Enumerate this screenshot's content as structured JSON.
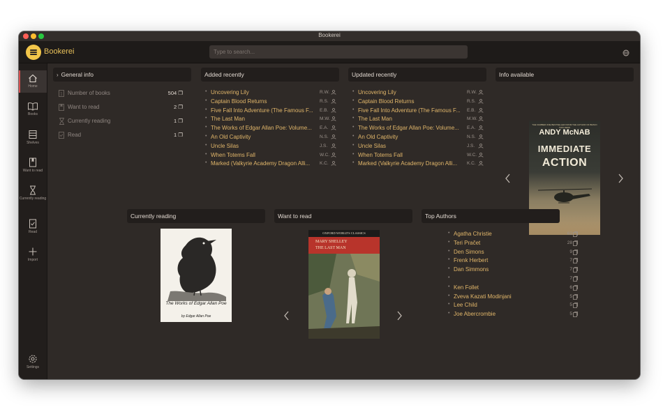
{
  "window": {
    "title": "Bookerei"
  },
  "app": {
    "name": "Bookerei"
  },
  "search": {
    "placeholder": "Type to search..."
  },
  "sidebar": {
    "items": [
      {
        "label": "Home",
        "icon": "home-icon"
      },
      {
        "label": "Books",
        "icon": "book-icon"
      },
      {
        "label": "Shelves",
        "icon": "shelves-icon"
      },
      {
        "label": "Want to read",
        "icon": "bookmark-icon"
      },
      {
        "label": "Currently reading",
        "icon": "hourglass-icon"
      },
      {
        "label": "Read",
        "icon": "bookmark-check-icon"
      },
      {
        "label": "Import",
        "icon": "plus-icon"
      }
    ],
    "settings_label": "Settings"
  },
  "general_info": {
    "title": "General info",
    "rows": [
      {
        "label": "Number of books",
        "count": "504"
      },
      {
        "label": "Want to read",
        "count": "2"
      },
      {
        "label": "Currently reading",
        "count": "1"
      },
      {
        "label": "Read",
        "count": "1"
      }
    ]
  },
  "added_recently": {
    "title": "Added recently",
    "items": [
      {
        "title": "Uncovering Lily",
        "author": "R.W."
      },
      {
        "title": "Captain Blood Returns",
        "author": "R.S."
      },
      {
        "title": "Five Fall Into Adventure (The Famous F...",
        "author": "E.B."
      },
      {
        "title": "The Last Man",
        "author": "M.W."
      },
      {
        "title": "The Works of Edgar Allan Poe: Volume...",
        "author": "E.A."
      },
      {
        "title": "An Old Captivity",
        "author": "N.S."
      },
      {
        "title": "Uncle Silas",
        "author": "J.S."
      },
      {
        "title": "When Totems Fall",
        "author": "W.C."
      },
      {
        "title": "Marked (Valkyrie Academy Dragon Alli...",
        "author": "K.C."
      }
    ]
  },
  "updated_recently": {
    "title": "Updated recently",
    "items": [
      {
        "title": "Uncovering Lily",
        "author": "R.W."
      },
      {
        "title": "Captain Blood Returns",
        "author": "R.S."
      },
      {
        "title": "Five Fall Into Adventure (The Famous F...",
        "author": "E.B."
      },
      {
        "title": "The Last Man",
        "author": "M.W."
      },
      {
        "title": "The Works of Edgar Allan Poe: Volume...",
        "author": "E.A."
      },
      {
        "title": "An Old Captivity",
        "author": "N.S."
      },
      {
        "title": "Uncle Silas",
        "author": "J.S."
      },
      {
        "title": "When Totems Fall",
        "author": "W.C."
      },
      {
        "title": "Marked (Valkyrie Academy Dragon Alli...",
        "author": "K.C."
      }
    ]
  },
  "info_available": {
    "title": "Info available",
    "cover": {
      "tagline": "THE NUMBER ONE BESTSELLER FROM THE AUTHOR OF BRAVO TWO ZERO",
      "author": "ANDY McNAB",
      "title_line1": "IMMEDIATE",
      "title_line2": "ACTION"
    }
  },
  "currently_reading": {
    "title": "Currently reading",
    "cover": {
      "title": "The Works of Edgar Allan Poe",
      "subtitle": "by Edgar Allan Poe"
    }
  },
  "want_to_read": {
    "title": "Want to read",
    "cover": {
      "series": "OXFORD WORLD'S CLASSICS",
      "author": "MARY SHELLEY",
      "title": "THE LAST MAN"
    }
  },
  "top_authors": {
    "title": "Top Authors",
    "items": [
      {
        "name": "Agatha Christie",
        "count": "62"
      },
      {
        "name": "Teri Pračet",
        "count": "28"
      },
      {
        "name": "Den Simons",
        "count": "9"
      },
      {
        "name": "Frenk Herbert",
        "count": "7"
      },
      {
        "name": "Dan Simmons",
        "count": "7"
      },
      {
        "name": "",
        "count": "7"
      },
      {
        "name": "Ken Follet",
        "count": "6"
      },
      {
        "name": "Zveva Kazati Modinjani",
        "count": "5"
      },
      {
        "name": "Lee Child",
        "count": "5"
      },
      {
        "name": "Joe Abercrombie",
        "count": "5"
      }
    ]
  },
  "colors": {
    "accent": "#e9c15a",
    "list_text": "#e1b66a",
    "active_indicator": "#d65252",
    "panel": "#221e1c",
    "background": "#2f2a27"
  }
}
